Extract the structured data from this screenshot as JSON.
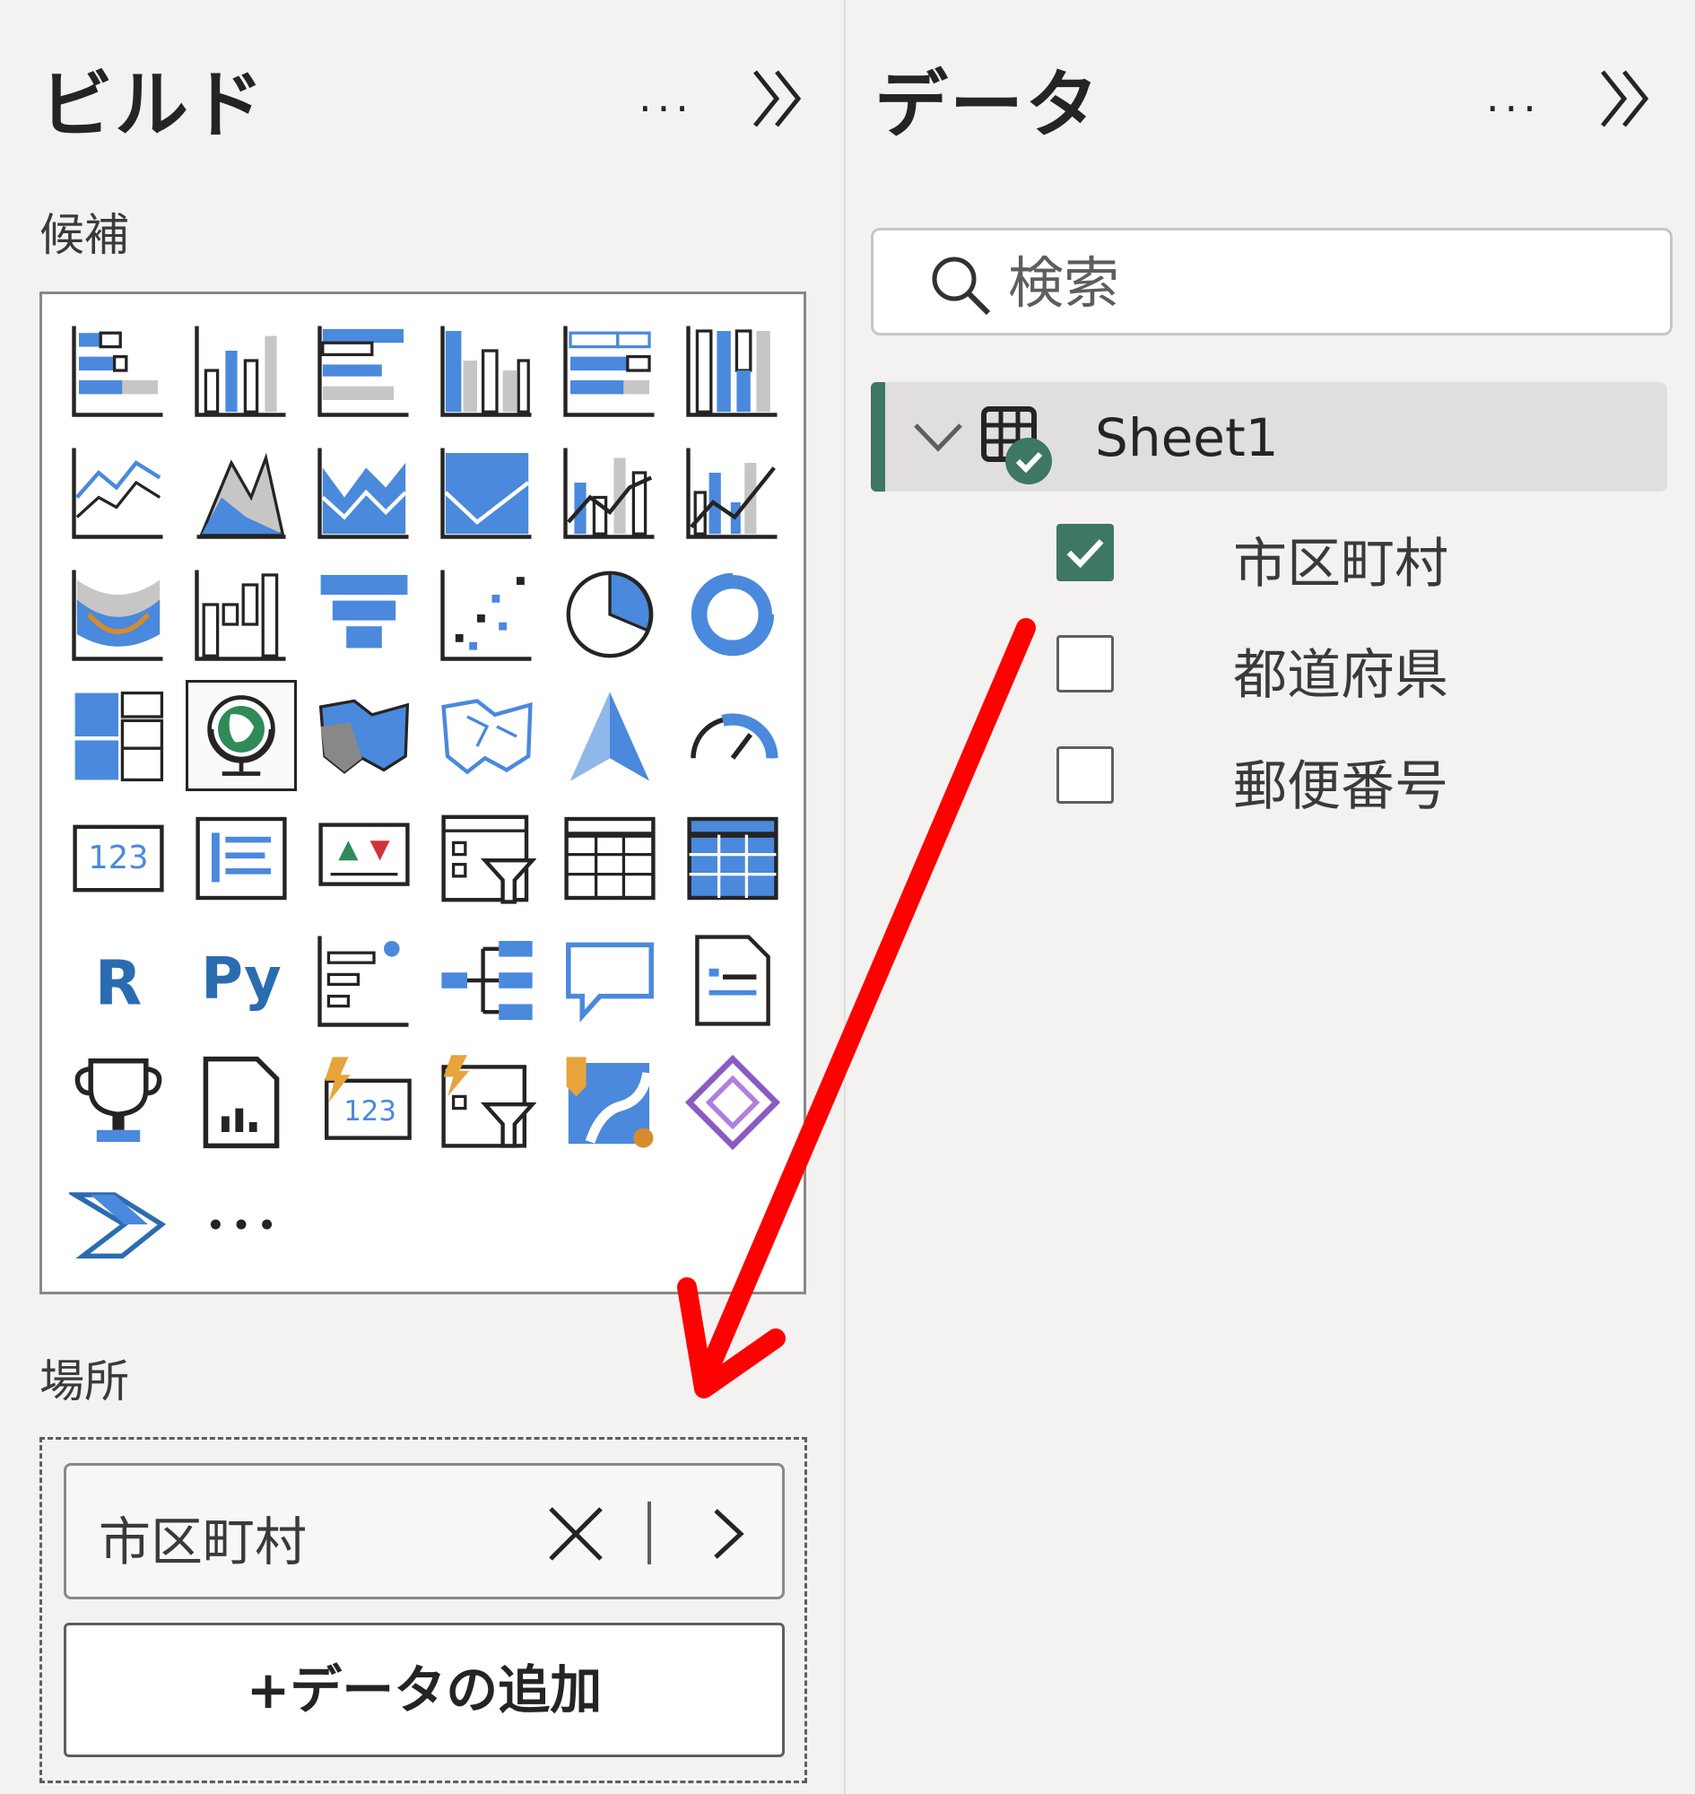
{
  "build_pane": {
    "title": "ビルド",
    "more_label": "···",
    "suggested_label": "候補",
    "visuals": [
      "stacked-bar-chart-icon",
      "stacked-column-chart-icon",
      "clustered-bar-chart-icon",
      "clustered-column-chart-icon",
      "100-stacked-bar-chart-icon",
      "100-stacked-column-chart-icon",
      "line-chart-icon",
      "area-chart-icon",
      "stacked-area-chart-icon",
      "100-stacked-area-chart-icon",
      "line-and-stacked-column-chart-icon",
      "line-and-clustered-column-chart-icon",
      "ribbon-chart-icon",
      "waterfall-chart-icon",
      "funnel-chart-icon",
      "scatter-chart-icon",
      "pie-chart-icon",
      "donut-chart-icon",
      "treemap-icon",
      "map-globe-icon",
      "filled-map-icon",
      "shape-map-icon",
      "azure-map-icon",
      "gauge-icon",
      "card-icon",
      "multi-row-card-icon",
      "kpi-icon",
      "slicer-icon",
      "table-icon",
      "matrix-icon",
      "r-script-visual-icon",
      "python-visual-icon",
      "key-influencers-icon",
      "decomposition-tree-icon",
      "qa-icon",
      "smart-narrative-icon",
      "metrics-icon",
      "paginated-report-icon",
      "new-card-icon",
      "new-slicer-icon",
      "arcgis-map-icon",
      "power-apps-icon",
      "power-automate-icon",
      "more-visuals-icon"
    ],
    "selected_visual": "map-globe-icon",
    "location_label": "場所",
    "location_field": "市区町村",
    "add_data_label": "+データの追加"
  },
  "data_pane": {
    "title": "データ",
    "more_label": "···",
    "search_placeholder": "検索",
    "table_name": "Sheet1",
    "fields": [
      {
        "label": "市区町村",
        "checked": true
      },
      {
        "label": "都道府県",
        "checked": false
      },
      {
        "label": "郵便番号",
        "checked": false
      }
    ]
  },
  "colors": {
    "accent_green": "#3e7764",
    "icon_blue": "#4a89dc",
    "icon_grey": "#c8c6c4",
    "annotation_red": "#ff0000"
  }
}
